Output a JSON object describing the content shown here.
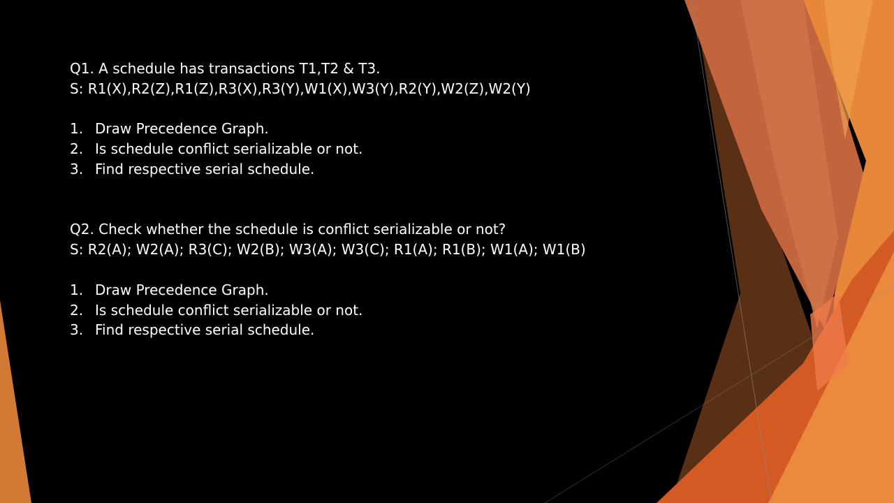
{
  "q1": {
    "title": "Q1. A schedule has transactions T1,T2 & T3.",
    "schedule": "S: R1(X),R2(Z),R1(Z),R3(X),R3(Y),W1(X),W3(Y),R2(Y),W2(Z),W2(Y)",
    "items": [
      {
        "num": "1.",
        "text": "Draw Precedence Graph."
      },
      {
        "num": "2.",
        "text": "Is schedule conflict serializable or not."
      },
      {
        "num": "3.",
        "text": "Find respective serial schedule."
      }
    ]
  },
  "q2": {
    "title": "Q2. Check whether the schedule is conflict serializable or not?",
    "schedule": "S: R2(A); W2(A); R3(C); W2(B); W3(A); W3(C); R1(A); R1(B); W1(A); W1(B)",
    "items": [
      {
        "num": "1.",
        "text": "Draw Precedence Graph."
      },
      {
        "num": "2.",
        "text": "Is schedule conflict serializable or not."
      },
      {
        "num": "3.",
        "text": "Find respective serial schedule."
      }
    ]
  },
  "colors": {
    "background": "#000000",
    "text": "#ffffff",
    "accent_orange": "#e8883a",
    "accent_dark_orange": "#d4541f",
    "accent_brown": "#6b3a1a",
    "accent_rust": "#c8673f"
  }
}
